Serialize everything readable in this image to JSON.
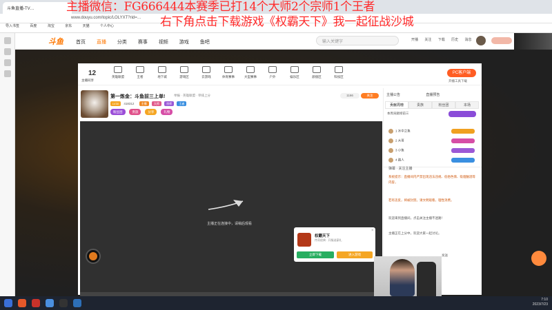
{
  "browser": {
    "tab_title": "斗鱼直播-TV…",
    "url": "www.douyu.com/topic/LOLYXT?rid=…",
    "bookmarks": [
      "导入书签",
      "百度",
      "淘宝",
      "京东",
      "天猫",
      "个人中心"
    ]
  },
  "overlay": {
    "line1": "主播微信：FG666444本赛季已打14个大师2个宗师1个王者",
    "line2": "右下角点击下载游戏《权霸天下》我一起征战沙城"
  },
  "site": {
    "logo": "斗鱼",
    "nav": [
      "首页",
      "直播",
      "分类",
      "赛事",
      "视频",
      "游戏",
      "鱼吧"
    ],
    "search_placeholder": "输入关键字",
    "top_icons": [
      "开播",
      "关注",
      "下载",
      "历史",
      "消息"
    ]
  },
  "header": {
    "count": "12",
    "count_label": "主播同享",
    "categories": [
      "英雄联盟",
      "王者",
      "地下城",
      "游戏区",
      "云游戏",
      "体育赛事",
      "大型赛事",
      "户外",
      "娱乐区",
      "颜值区",
      "科技区"
    ],
    "pc_button": "PC客户端",
    "pc_sub": "开播工具下载"
  },
  "room": {
    "title": "第一炼金：斗鱼前三上单!",
    "meta": "举报 · 英雄联盟 · 单排上分",
    "level": "LV30",
    "fans": "418312",
    "hot": "1166",
    "follow": "关注",
    "badges": [
      "主播",
      "大师",
      "宗师",
      "王者"
    ],
    "gift_buttons": [
      "粉丝团",
      "贵族",
      "分享",
      "礼物"
    ]
  },
  "video": {
    "loading_text": "主播正在连接中，请稍后观看"
  },
  "popup": {
    "game_name": "权霸天下",
    "desc": "传奇经典 · 开服送豪礼",
    "btn1": "立即下载",
    "btn2": "进入游戏",
    "close": "×"
  },
  "right_panel": {
    "top_links": [
      "主播公告",
      "直播预告"
    ],
    "tabs": [
      "贡献周榜",
      "贵族",
      "粉丝团",
      "本场"
    ],
    "row1": "本周贡献榜前三",
    "ranks": [
      "1 水中之鱼",
      "2 大哥",
      "3 小鱼",
      "4 路人"
    ],
    "chat_head": "弹幕 · 关注主播",
    "chat_lines": [
      "系统提示：直播间内严禁出现违法违规、低俗色情、吸烟酗酒等内容，",
      "若有违反，将被封禁。请文明观看，理性消费。",
      "欢迎来到直播间，点击关注主播不迷路！",
      "主播正在上分中，欢迎大家一起讨论。"
    ],
    "send_label": "发送"
  },
  "taskbar": {
    "time": "7:10",
    "date": "2023/7/23"
  }
}
